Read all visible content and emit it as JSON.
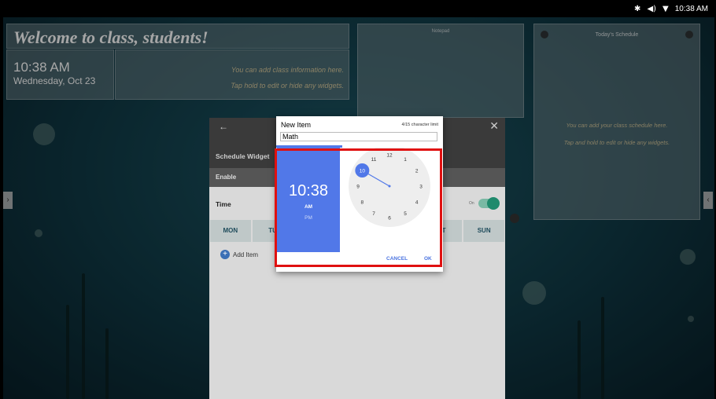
{
  "status_bar": {
    "bluetooth_icon": "✱",
    "volume_icon": "◀)",
    "wifi_icon": "▼",
    "time": "10:38 AM"
  },
  "welcome": {
    "title": "Welcome to class, students!"
  },
  "clock": {
    "time": "10:38 AM",
    "date": "Wednesday, Oct 23"
  },
  "info": {
    "line1": "You can add class information here.",
    "line2": "Tap hold to edit or hide any widgets."
  },
  "notepad": {
    "title": "Notepad"
  },
  "schedule_widget": {
    "title": "Today's Schedule",
    "line1": "You can add your class schedule here.",
    "line2": "Tap and hold to edit or hide any widgets."
  },
  "panel": {
    "title": "Schedule Widget",
    "enable_label": "Enable",
    "time_label": "Time",
    "toggle_label": "On",
    "days": [
      "MON",
      "TU",
      "",
      "",
      "",
      "AT",
      "SUN"
    ],
    "add_item_label": "Add Item"
  },
  "dialog": {
    "title": "New Item",
    "char_limit": "4/15 character limit",
    "input_value": "Math",
    "time_hour": "10",
    "time_minute": "38",
    "am_label": "AM",
    "pm_label": "PM",
    "selected_period": "AM",
    "clock_numbers": [
      "12",
      "1",
      "2",
      "3",
      "4",
      "5",
      "6",
      "7",
      "8",
      "9",
      "10",
      "11"
    ],
    "selected_hour": 10,
    "cancel_label": "CANCEL",
    "ok_label": "OK"
  },
  "colors": {
    "accent": "#5178e8",
    "toggle": "#1f8a6c",
    "highlight": "#e01010"
  }
}
